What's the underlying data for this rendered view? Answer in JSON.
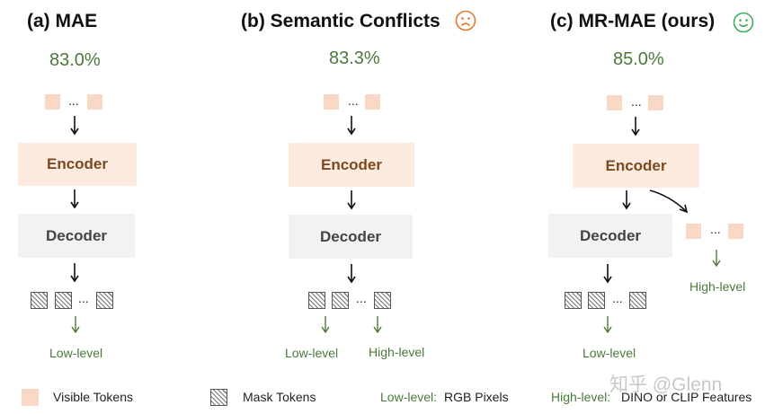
{
  "panels": {
    "a": {
      "title": "(a) MAE",
      "accuracy": "83.0%",
      "encoder": "Encoder",
      "decoder": "Decoder",
      "low_label": "Low-level"
    },
    "b": {
      "title": "(b) Semantic Conflicts",
      "accuracy": "83.3%",
      "encoder": "Encoder",
      "decoder": "Decoder",
      "low_label": "Low-level",
      "high_label": "High-level",
      "face_icon": "sad-face",
      "face_color": "#e07a2e"
    },
    "c": {
      "title": "(c) MR-MAE (ours)",
      "accuracy": "85.0%",
      "encoder": "Encoder",
      "decoder": "Decoder",
      "low_label": "Low-level",
      "high_label": "High-level",
      "face_icon": "happy-face",
      "face_color": "#3cae5a"
    }
  },
  "dots": "...",
  "legend": {
    "visible_tokens": "Visible Tokens",
    "mask_tokens": "Mask Tokens",
    "low_key": "Low-level:",
    "low_value": "RGB Pixels",
    "high_key": "High-level:",
    "high_value": "DINO or CLIP Features"
  },
  "watermark": "知乎 @Glenn",
  "colors": {
    "token": "#f9d8c6",
    "encoder_bg": "#fdebdf",
    "encoder_text": "#7a4a22",
    "decoder_bg": "#f2f2f2",
    "green": "#4a7a3a"
  }
}
